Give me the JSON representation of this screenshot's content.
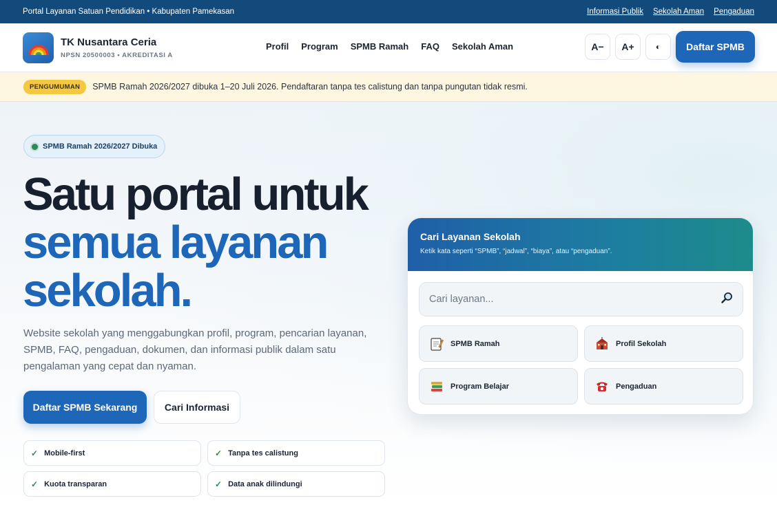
{
  "topbar": {
    "title": "Portal Layanan Satuan Pendidikan • Kabupaten Pamekasan",
    "links": [
      "Informasi Publik",
      "Sekolah Aman",
      "Pengaduan"
    ]
  },
  "brand": {
    "name": "TK Nusantara Ceria",
    "sub": "NPSN 20500003 • AKREDITASI A",
    "logo_icon": "rainbow-icon"
  },
  "nav": [
    "Profil",
    "Program",
    "SPMB Ramah",
    "FAQ",
    "Sekolah Aman"
  ],
  "tools": {
    "font_decrease": "A−",
    "font_increase": "A+",
    "contrast_icon": "contrast-icon",
    "contrast_glyph": "◐",
    "register": "Daftar SPMB"
  },
  "announcement": {
    "badge": "PENGUMUMAN",
    "text": "SPMB Ramah 2026/2027 dibuka 1–20 Juli 2026. Pendaftaran tanpa tes calistung dan tanpa pungutan tidak resmi."
  },
  "hero": {
    "pill": "SPMB Ramah 2026/2027 Dibuka",
    "title_line1": "Satu portal untuk",
    "title_line2": "semua layanan",
    "title_line3": "sekolah.",
    "description": "Website sekolah yang menggabungkan profil, program, pencarian layanan, SPMB, FAQ, pengaduan, dokumen, dan informasi publik dalam satu pengalaman yang cepat dan nyaman.",
    "cta_primary": "Daftar SPMB Sekarang",
    "cta_secondary": "Cari Informasi",
    "features": [
      "Mobile-first",
      "Tanpa tes calistung",
      "Kuota transparan",
      "Data anak dilindungi"
    ],
    "check_glyph": "✓"
  },
  "search_card": {
    "title": "Cari Layanan Sekolah",
    "subtitle": "Ketik kata seperti “SPMB”, “jadwal”, “biaya”, atau “pengaduan”.",
    "placeholder": "Cari layanan...",
    "search_icon": "magnifier-icon",
    "services": [
      {
        "label": "SPMB Ramah",
        "icon": "memo-icon"
      },
      {
        "label": "Profil Sekolah",
        "icon": "school-icon"
      },
      {
        "label": "Program Belajar",
        "icon": "books-icon"
      },
      {
        "label": "Pengaduan",
        "icon": "telephone-icon"
      }
    ]
  },
  "colors": {
    "topbar": "#134a7c",
    "primary": "#1e67b8",
    "accent_green": "#2e8b57",
    "badge_yellow": "#f5c841",
    "announce_bg": "#fdf7e2"
  }
}
